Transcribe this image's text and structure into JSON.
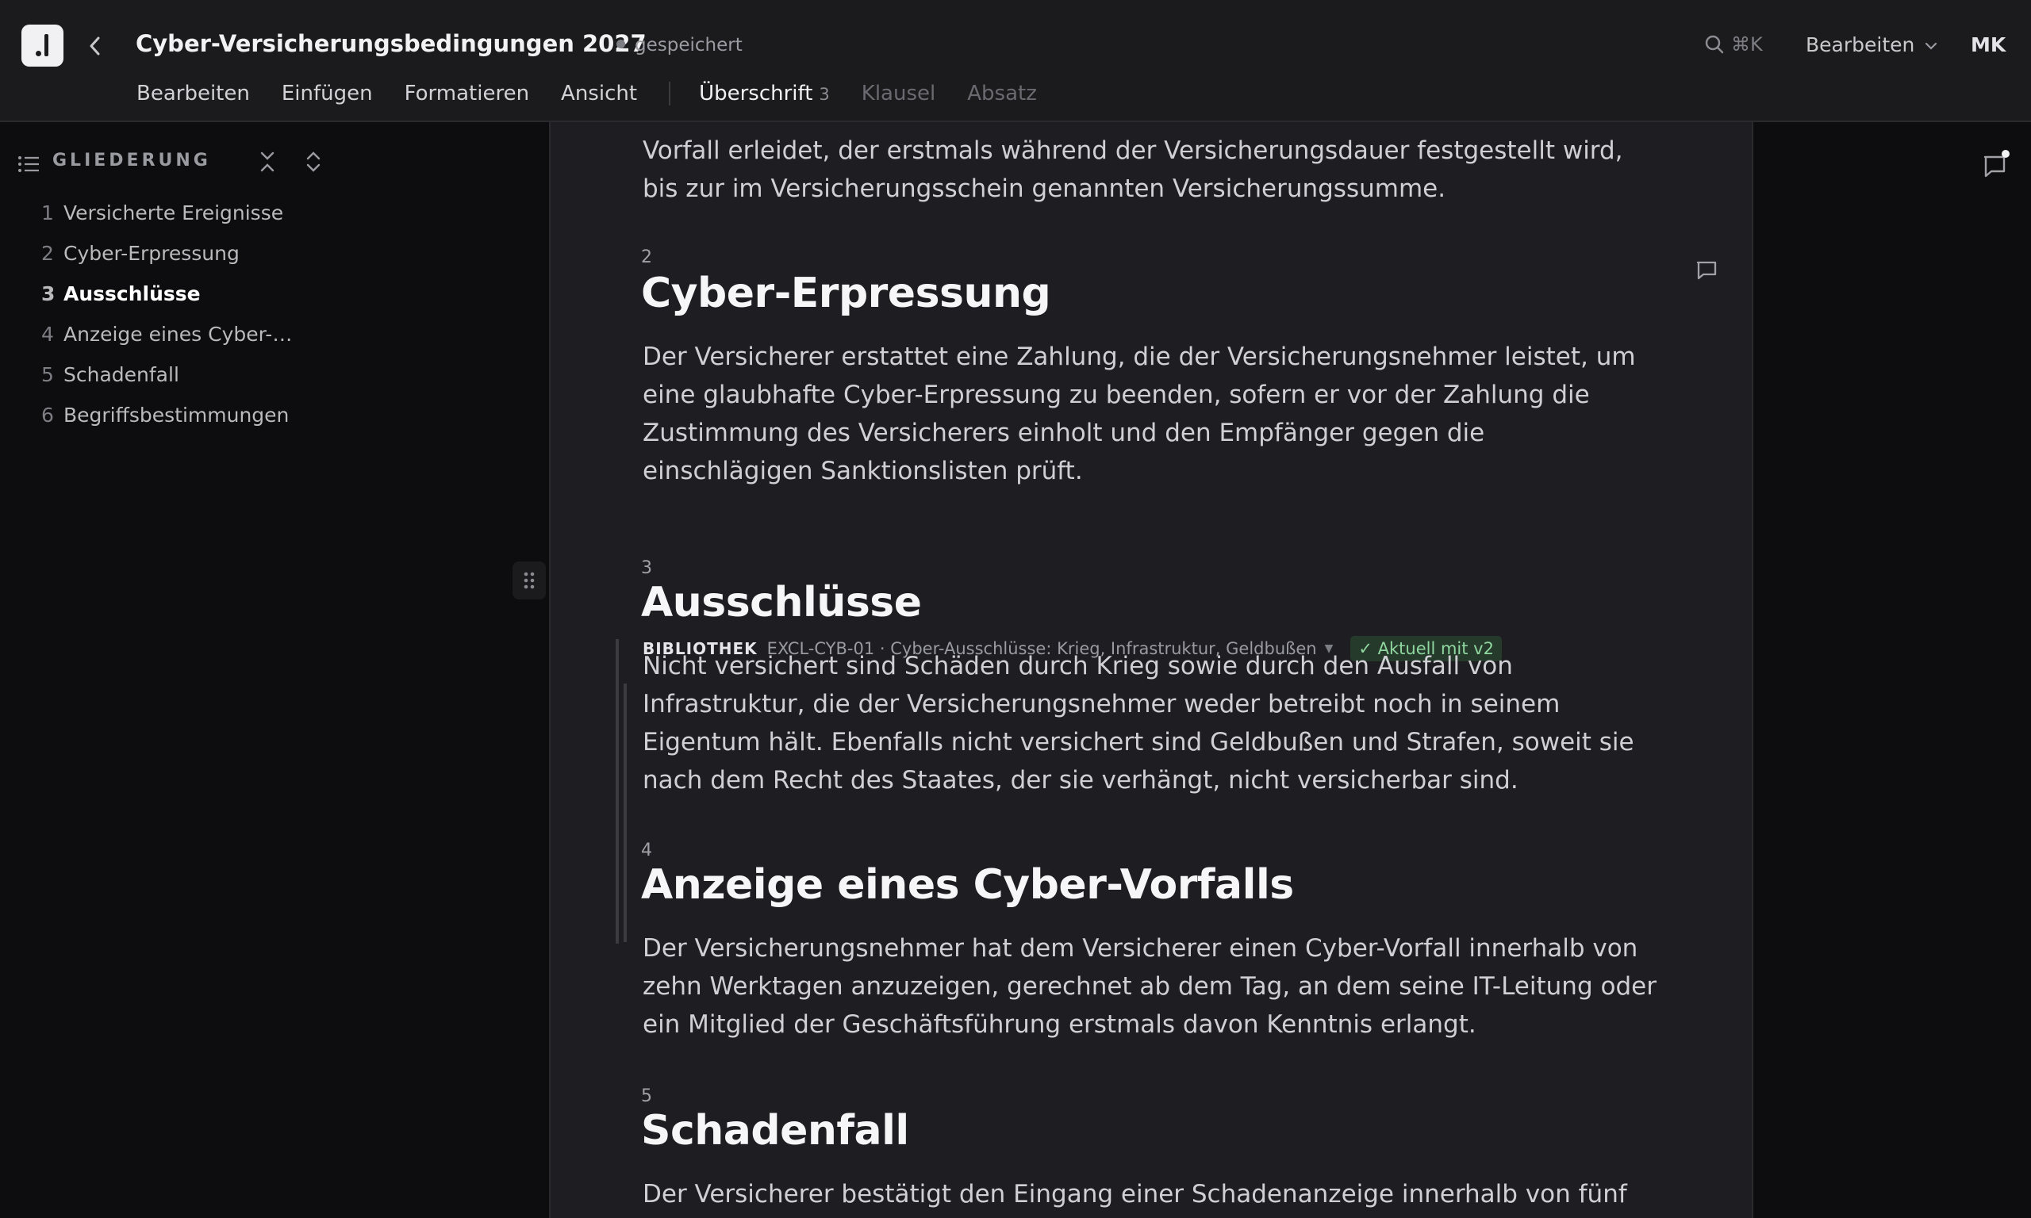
{
  "header": {
    "title": "Cyber-Versicherungsbedingungen 2027",
    "save_status": "gespeichert",
    "search_shortcut": "⌘K",
    "mode_label": "Bearbeiten",
    "user_initials": "MK"
  },
  "menu": {
    "items": [
      "Bearbeiten",
      "Einfügen",
      "Formatieren",
      "Ansicht"
    ],
    "context": [
      {
        "label": "Überschrift",
        "badge": "3"
      },
      {
        "label": "Klausel"
      },
      {
        "label": "Absatz"
      }
    ]
  },
  "outline": {
    "title": "GLIEDERUNG",
    "items": [
      {
        "num": "1",
        "label": "Versicherte Ereignisse"
      },
      {
        "num": "2",
        "label": "Cyber-Erpressung"
      },
      {
        "num": "3",
        "label": "Ausschlüsse"
      },
      {
        "num": "4",
        "label": "Anzeige eines Cyber-…"
      },
      {
        "num": "5",
        "label": "Schadenfall"
      },
      {
        "num": "6",
        "label": "Begriffsbestimmungen"
      }
    ],
    "active_index": 2
  },
  "document": {
    "intro_tail": "Vorfall erleidet, der erstmals während der Versicherungsdauer festgestellt wird, bis zur im Versicherungsschein genannten Versicherungssumme.",
    "sections": [
      {
        "num": "2",
        "title": "Cyber-Erpressung",
        "body": "Der Versicherer erstattet eine Zahlung, die der Versicherungsnehmer leistet, um eine glaubhafte Cyber-Erpressung zu beenden, sofern er vor der Zahlung die Zustimmung des Versicherers einholt und den Empfänger gegen die einschlägigen Sanktionslisten prüft."
      },
      {
        "num": "3",
        "title": "Ausschlüsse",
        "body": "Nicht versichert sind Schäden durch Krieg sowie durch den Ausfall von Infrastruktur, die der Versicherungsnehmer weder betreibt noch in seinem Eigentum hält. Ebenfalls nicht versichert sind Geldbußen und Strafen, soweit sie nach dem Recht des Staates, der sie verhängt, nicht versicherbar sind."
      },
      {
        "num": "4",
        "title": "Anzeige eines Cyber-Vorfalls",
        "body": "Der Versicherungsnehmer hat dem Versicherer einen Cyber-Vorfall innerhalb von zehn Werktagen anzuzeigen, gerechnet ab dem Tag, an dem seine IT-Leitung oder ein Mitglied der Geschäftsführung erstmals davon Kenntnis erlangt."
      },
      {
        "num": "5",
        "title": "Schadenfall",
        "body": "Der Versicherer bestätigt den Eingang einer Schadenanzeige innerhalb von fünf"
      }
    ],
    "library": {
      "tag": "BIBLIOTHEK",
      "reference": "EXCL-CYB-01 · Cyber-Ausschlüsse: Krieg, Infrastruktur, Geldbußen",
      "status": "✓ Aktuell mit v2",
      "status_color": "#8fd69f"
    }
  }
}
